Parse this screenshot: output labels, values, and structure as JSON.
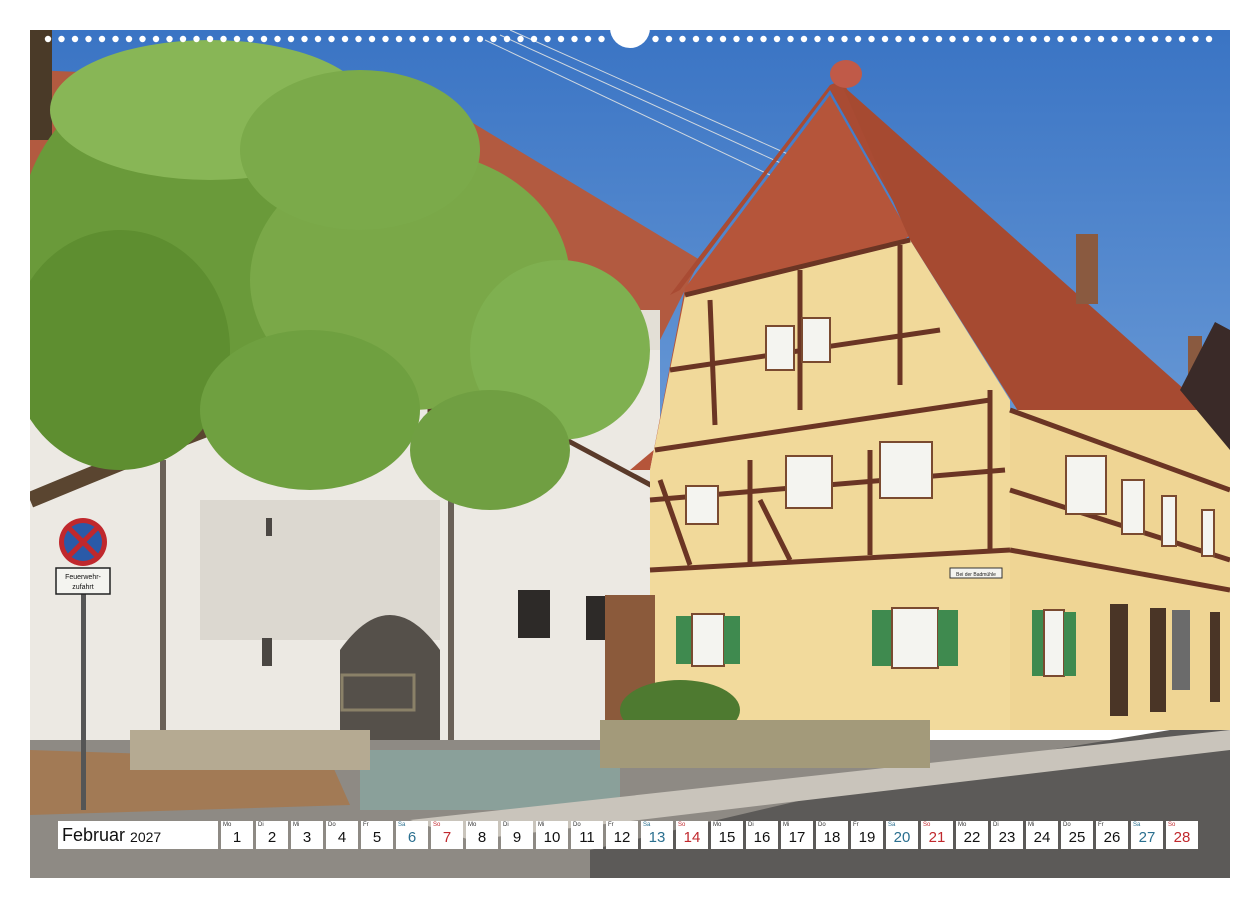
{
  "calendar": {
    "month": "Februar",
    "year": "2027",
    "days": [
      {
        "wd": "Mo",
        "d": "1",
        "t": "wk"
      },
      {
        "wd": "Di",
        "d": "2",
        "t": "wk"
      },
      {
        "wd": "Mi",
        "d": "3",
        "t": "wk"
      },
      {
        "wd": "Do",
        "d": "4",
        "t": "wk"
      },
      {
        "wd": "Fr",
        "d": "5",
        "t": "wk"
      },
      {
        "wd": "Sa",
        "d": "6",
        "t": "sat"
      },
      {
        "wd": "So",
        "d": "7",
        "t": "sun"
      },
      {
        "wd": "Mo",
        "d": "8",
        "t": "wk"
      },
      {
        "wd": "Di",
        "d": "9",
        "t": "wk"
      },
      {
        "wd": "Mi",
        "d": "10",
        "t": "wk"
      },
      {
        "wd": "Do",
        "d": "11",
        "t": "wk"
      },
      {
        "wd": "Fr",
        "d": "12",
        "t": "wk"
      },
      {
        "wd": "Sa",
        "d": "13",
        "t": "sat"
      },
      {
        "wd": "So",
        "d": "14",
        "t": "sun"
      },
      {
        "wd": "Mo",
        "d": "15",
        "t": "wk"
      },
      {
        "wd": "Di",
        "d": "16",
        "t": "wk"
      },
      {
        "wd": "Mi",
        "d": "17",
        "t": "wk"
      },
      {
        "wd": "Do",
        "d": "18",
        "t": "wk"
      },
      {
        "wd": "Fr",
        "d": "19",
        "t": "wk"
      },
      {
        "wd": "Sa",
        "d": "20",
        "t": "sat"
      },
      {
        "wd": "So",
        "d": "21",
        "t": "sun"
      },
      {
        "wd": "Mo",
        "d": "22",
        "t": "wk"
      },
      {
        "wd": "Di",
        "d": "23",
        "t": "wk"
      },
      {
        "wd": "Mi",
        "d": "24",
        "t": "wk"
      },
      {
        "wd": "Do",
        "d": "25",
        "t": "wk"
      },
      {
        "wd": "Fr",
        "d": "26",
        "t": "wk"
      },
      {
        "wd": "Sa",
        "d": "27",
        "t": "sat"
      },
      {
        "wd": "So",
        "d": "28",
        "t": "sun"
      }
    ]
  },
  "sign": {
    "line1": "Feuerwehr-",
    "line2": "zufahrt"
  },
  "street_sign": "Bei der Badmühle",
  "colors": {
    "sky": "#3f78c6",
    "roof": "#b5553a",
    "facade": "#f1d99a",
    "timber": "#6b3524",
    "shutter": "#3f8a4f",
    "saturday": "#2a6f8f",
    "sunday": "#c0282d"
  }
}
